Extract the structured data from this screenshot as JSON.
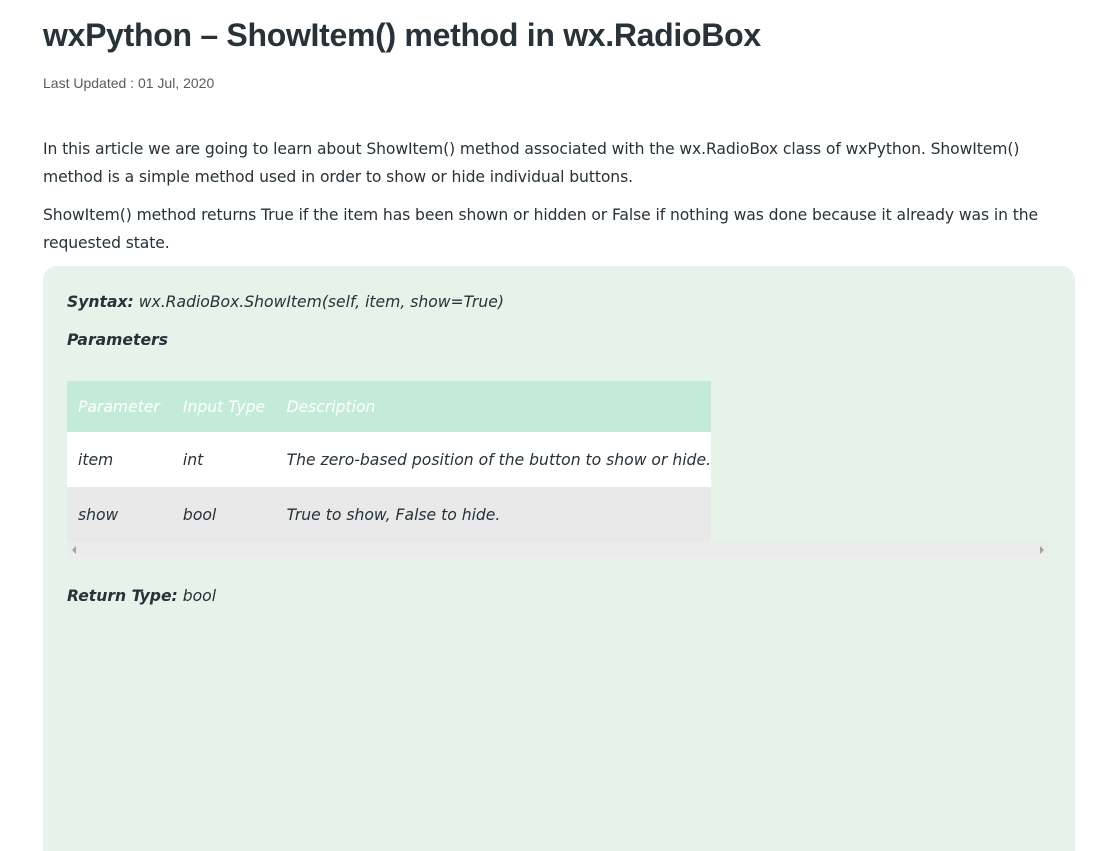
{
  "article": {
    "title": "wxPython – ShowItem() method in wx.RadioBox",
    "last_updated": "Last Updated : 01 Jul, 2020",
    "paragraphs": [
      "In this article we are going to learn about ShowItem() method associated with the wx.RadioBox class of wxPython. ShowItem() method is a simple method used in order to show or hide individual buttons.",
      "ShowItem() method returns True if the item has been shown or hidden or False if nothing was done because it already was in the requested state."
    ]
  },
  "code_box": {
    "syntax_label": "Syntax:",
    "syntax_value": " wx.RadioBox.ShowItem(self, item, show=True)",
    "parameters_label": "Parameters",
    "table": {
      "headers": [
        "Parameter",
        "Input Type",
        "Description"
      ],
      "rows": [
        [
          "item",
          "int",
          "The zero-based position of the button to show or hide."
        ],
        [
          "show",
          "bool",
          "True to show, False to hide."
        ]
      ]
    },
    "return_label": "Return Type:",
    "return_value": " bool"
  },
  "colors": {
    "code_box_bg": "#e7f2ea",
    "table_header_bg": "#c4ead8",
    "table_alt_row_bg": "#e9e9e9",
    "text": "#273239"
  }
}
